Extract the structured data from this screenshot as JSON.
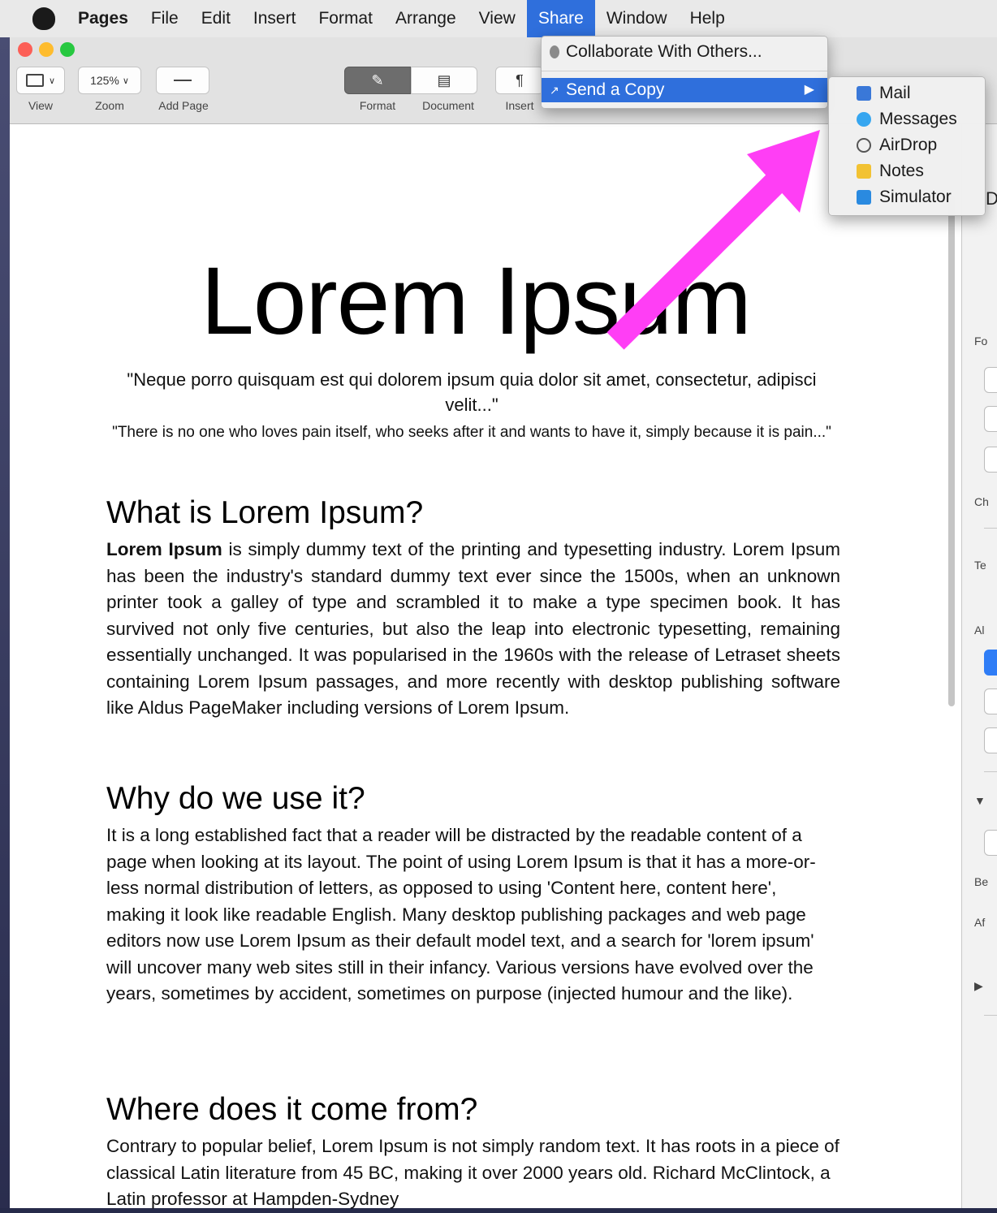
{
  "menubar": {
    "app": "Pages",
    "items": [
      "File",
      "Edit",
      "Insert",
      "Format",
      "Arrange",
      "View",
      "Share",
      "Window",
      "Help"
    ]
  },
  "toolbar": {
    "view_label": "View",
    "zoom_value": "125%",
    "zoom_label": "Zoom",
    "addpage_label": "Add Page",
    "format_label": "Format",
    "document_label": "Document",
    "insert_label": "Insert"
  },
  "share_menu": {
    "collaborate": "Collaborate With Others...",
    "send_copy": "Send a Copy",
    "submenu": [
      {
        "label": "Mail",
        "icon": "mail-icon",
        "color": "#3a78d8"
      },
      {
        "label": "Messages",
        "icon": "messages-icon",
        "color": "#36a6f0"
      },
      {
        "label": "AirDrop",
        "icon": "airdrop-icon",
        "color": "#555555"
      },
      {
        "label": "Notes",
        "icon": "notes-icon",
        "color": "#f2c233"
      },
      {
        "label": "Simulator",
        "icon": "simulator-icon",
        "color": "#2a8ae0"
      }
    ]
  },
  "annotation": {
    "arrow_color": "#ff3ef5"
  },
  "document": {
    "title": "Lorem Ipsum",
    "quote_latin": "\"Neque porro quisquam est qui dolorem ipsum quia dolor sit amet, consectetur, adipisci velit...\"",
    "quote_english": "\"There is no one who loves pain itself, who seeks after it and wants to have it, simply because it is pain...\"",
    "h1": "What is Lorem Ipsum?",
    "p1_bold": "Lorem Ipsum",
    "p1": " is simply dummy text of the printing and typesetting industry. Lorem Ipsum has been the industry's standard dummy text ever since the 1500s, when an unknown printer took a galley of type and scrambled it to make a type specimen book. It has survived not only five centuries, but also the leap into electronic typesetting, remaining essentially unchanged. It was popularised in the 1960s with the release of Letraset sheets containing Lorem Ipsum passages, and more recently with desktop publishing software like Aldus PageMaker including versions of Lorem Ipsum.",
    "h2": "Why do we use it?",
    "p2": "It is a long established fact that a reader will be distracted by the readable content of a page when looking at its layout. The point of using Lorem Ipsum is that it has a more-or-less normal distribution of letters, as opposed to using 'Content here, content here', making it look like readable English. Many desktop publishing packages and web page editors now use Lorem Ipsum as their default model text, and a search for 'lorem ipsum' will uncover many web sites still in their infancy. Various versions have evolved over the years, sometimes by accident, sometimes on purpose (injected humour and the like).",
    "h3": "Where does it come from?",
    "p3": "Contrary to popular belief, Lorem Ipsum is not simply random text. It has roots in a piece of classical Latin literature from 45 BC, making it over 2000 years old. Richard McClintock, a Latin professor at Hampden-Sydney"
  }
}
